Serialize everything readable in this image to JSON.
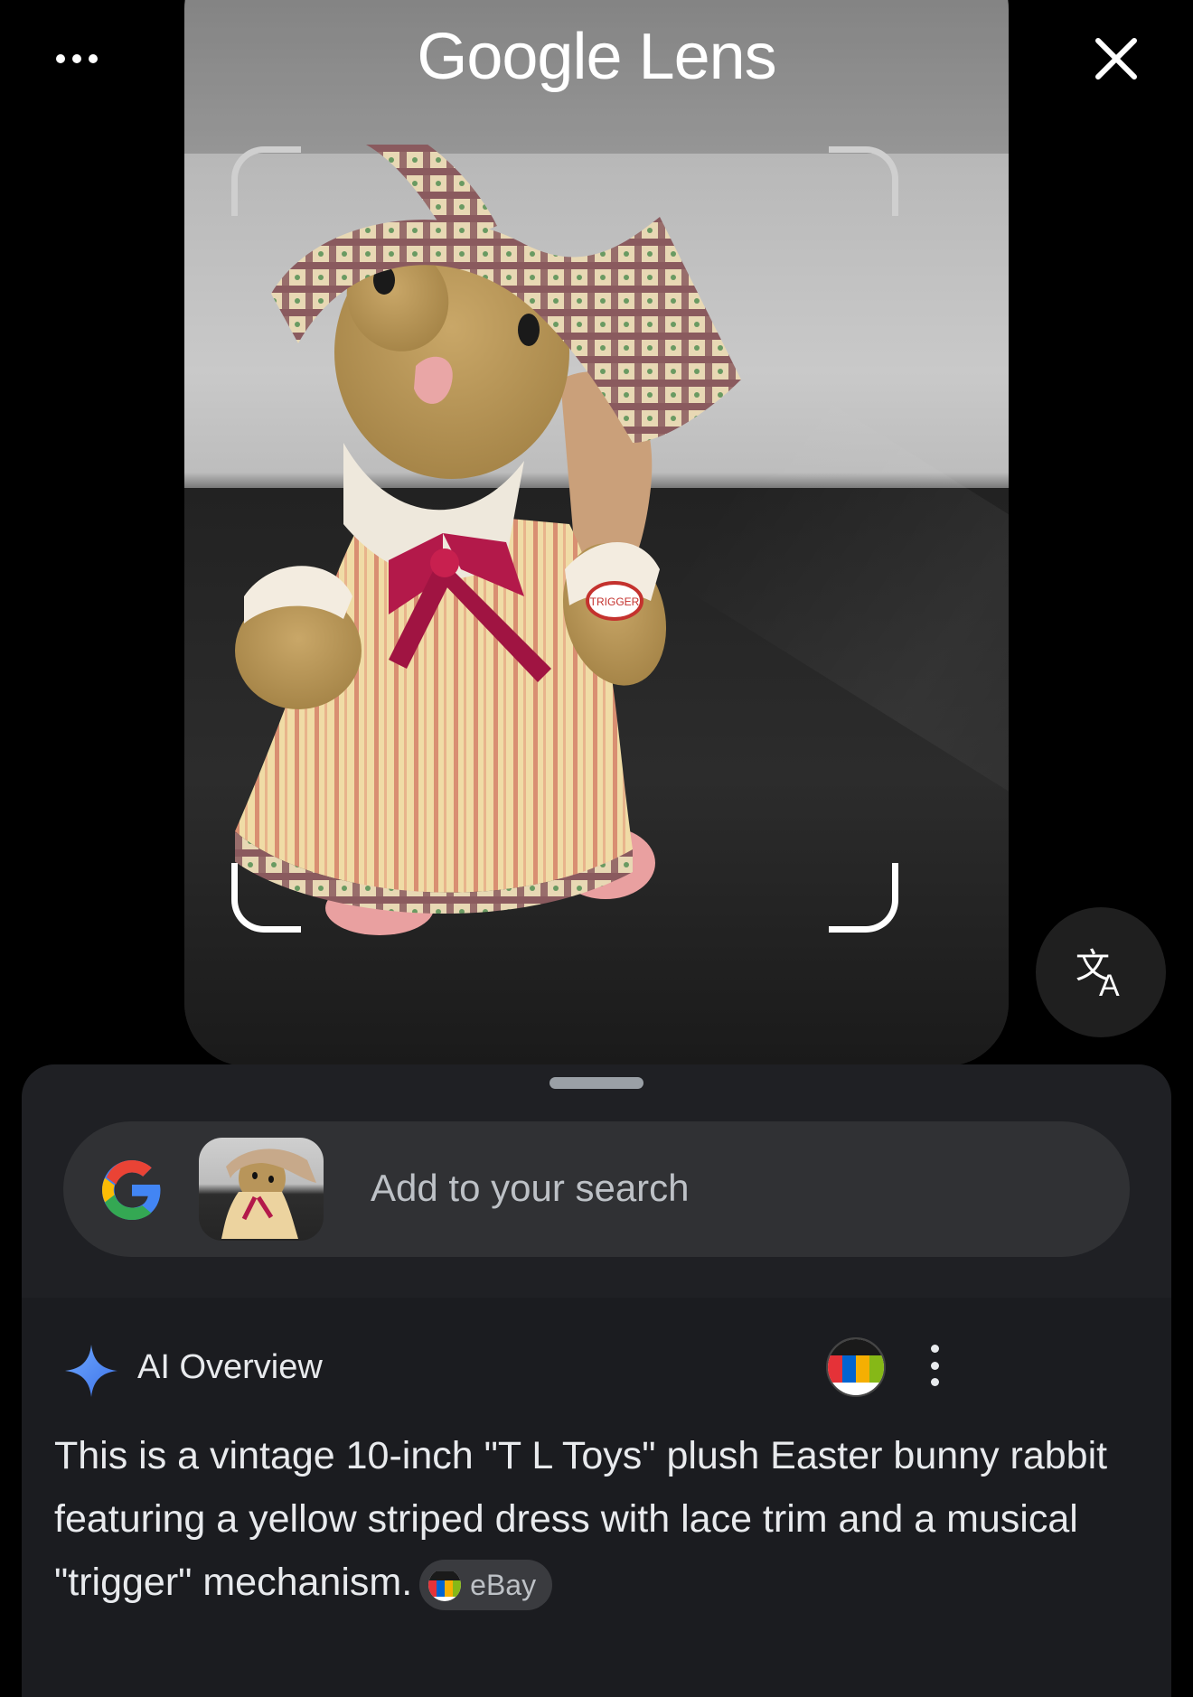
{
  "header": {
    "title": "Google Lens",
    "more_icon": "more-horiz-icon",
    "close_icon": "close-icon"
  },
  "translate": {
    "icon": "translate-icon"
  },
  "search": {
    "placeholder": "Add to your search",
    "logo": "google-g-logo"
  },
  "ai_overview": {
    "title": "AI Overview",
    "icon": "sparkle-icon",
    "text": "This is a vintage 10-inch \"T L Toys\" plush Easter bunny rabbit featuring a yellow striped dress with lace trim and a musical \"trigger\" mechanism.",
    "source_chip": "eBay"
  },
  "photo": {
    "tag_text": "TRIGGER"
  },
  "colors": {
    "sheet_bg": "#1f2024",
    "search_bg": "#303134",
    "accent_sparkle": "#4f8bf5"
  }
}
